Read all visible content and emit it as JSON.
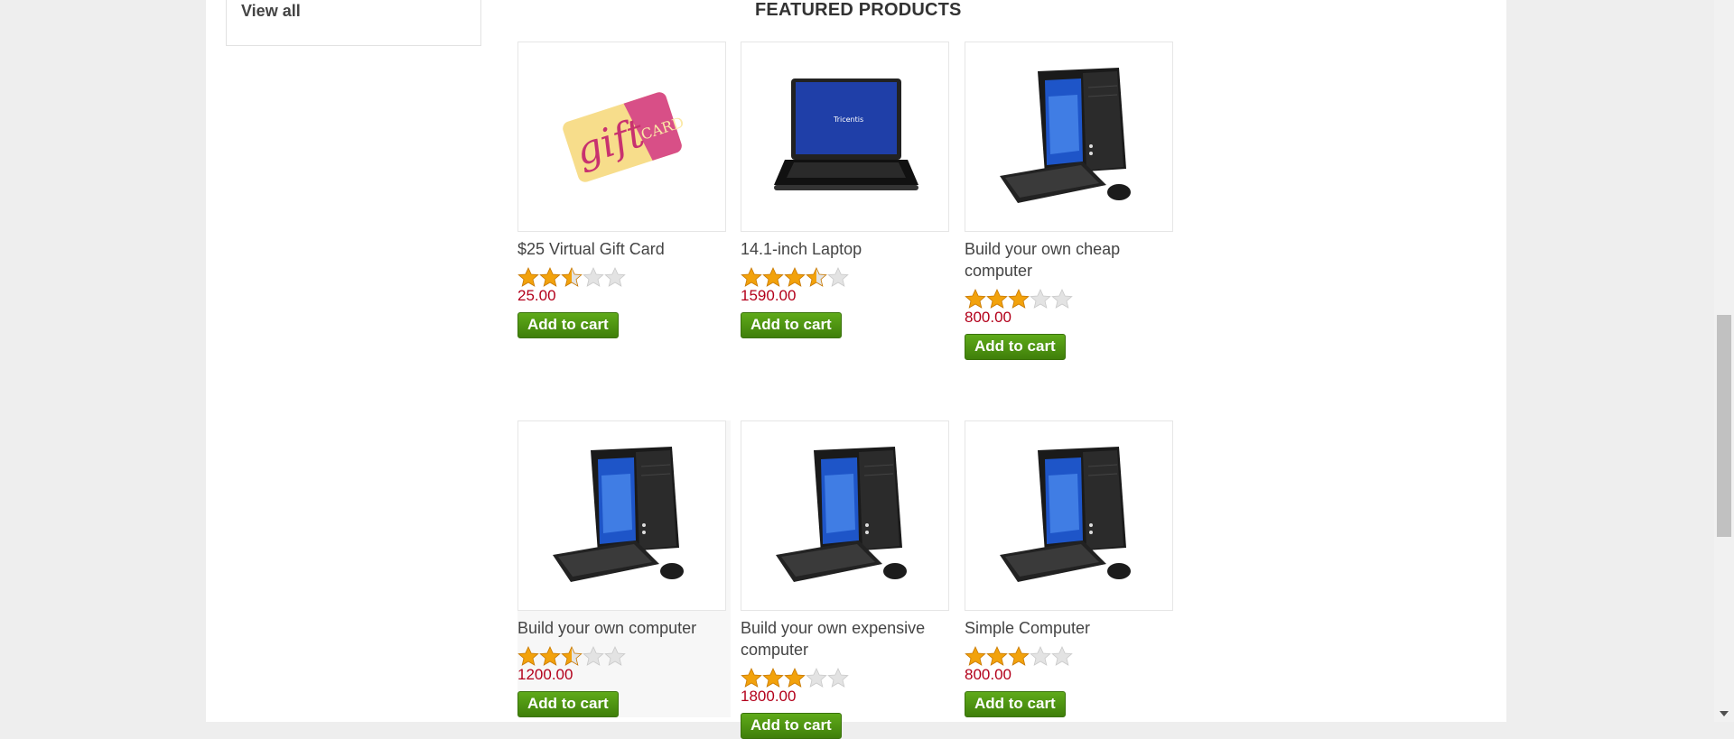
{
  "sidebar": {
    "view_all_label": "View all"
  },
  "section": {
    "title": "FEATURED PRODUCTS"
  },
  "products": [
    {
      "title": "$25 Virtual Gift Card",
      "rating": 2.5,
      "price": "25.00",
      "button": "Add to cart",
      "image": "gift-card"
    },
    {
      "title": "14.1-inch Laptop",
      "rating": 3.5,
      "price": "1590.00",
      "button": "Add to cart",
      "image": "laptop"
    },
    {
      "title": "Build your own cheap computer",
      "rating": 3,
      "price": "800.00",
      "button": "Add to cart",
      "image": "desktop-computer"
    },
    {
      "title": "Build your own computer",
      "rating": 2.5,
      "price": "1200.00",
      "button": "Add to cart",
      "image": "desktop-computer"
    },
    {
      "title": "Build your own expensive computer",
      "rating": 3,
      "price": "1800.00",
      "button": "Add to cart",
      "image": "desktop-computer"
    },
    {
      "title": "Simple Computer",
      "rating": 3,
      "price": "800.00",
      "button": "Add to cart",
      "image": "desktop-computer"
    }
  ],
  "colors": {
    "price": "#b3001b",
    "button": "#4a8f10",
    "star": "#f2a20c"
  }
}
